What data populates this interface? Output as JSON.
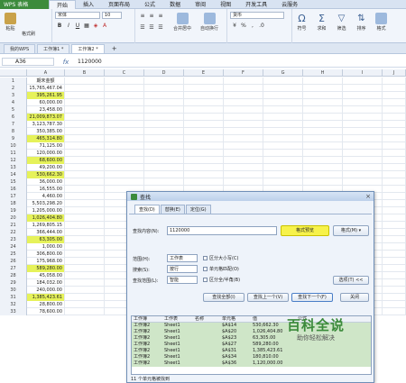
{
  "menubar": {
    "app_button": "WPS 表格",
    "items": [
      "开始",
      "插入",
      "页面布局",
      "公式",
      "数据",
      "审阅",
      "视图",
      "开发工具",
      "云服务"
    ],
    "active_index": 0
  },
  "ribbon": {
    "paste_label": "粘贴",
    "format_painter_label": "格式刷",
    "font_name": "宋体",
    "font_size": "10",
    "merge_label": "合并居中",
    "wrap_label": "自动换行",
    "number_format": "货币",
    "symbol_label": "符号",
    "sum_label": "求和",
    "filter_label": "筛选",
    "sort_label": "排序",
    "format_label": "格式",
    "accent_color": "#3c8b3c"
  },
  "tabs": {
    "items": [
      "我的WPS",
      "工作簿1 *",
      "工作簿2 *"
    ],
    "active_index": 2,
    "add_label": "+"
  },
  "formula_bar": {
    "cell_ref": "A36",
    "fx": "fx",
    "value": "1120000"
  },
  "sheet": {
    "columns": [
      "A",
      "B",
      "C",
      "D",
      "E",
      "F",
      "G",
      "H",
      "I",
      "J"
    ],
    "header_cell": "期末金额",
    "rows": [
      {
        "n": "1",
        "a": "期末金额",
        "hl": false
      },
      {
        "n": "2",
        "a": "15,765,467.04",
        "hl": false
      },
      {
        "n": "3",
        "a": "395,261.95",
        "hl": true
      },
      {
        "n": "4",
        "a": "60,000.00",
        "hl": false
      },
      {
        "n": "5",
        "a": "23,458.00",
        "hl": false
      },
      {
        "n": "6",
        "a": "21,009,873.07",
        "hl": true
      },
      {
        "n": "7",
        "a": "3,123,787.30",
        "hl": false
      },
      {
        "n": "8",
        "a": "350,385.00",
        "hl": false
      },
      {
        "n": "9",
        "a": "465,314.80",
        "hl": true
      },
      {
        "n": "10",
        "a": "71,125.00",
        "hl": false
      },
      {
        "n": "11",
        "a": "120,000.00",
        "hl": false
      },
      {
        "n": "12",
        "a": "68,600.00",
        "hl": true
      },
      {
        "n": "13",
        "a": "49,200.00",
        "hl": false
      },
      {
        "n": "14",
        "a": "530,662.30",
        "hl": true
      },
      {
        "n": "15",
        "a": "36,000.00",
        "hl": false
      },
      {
        "n": "16",
        "a": "16,555.00",
        "hl": false
      },
      {
        "n": "17",
        "a": "4,460.00",
        "hl": false
      },
      {
        "n": "18",
        "a": "5,503,298.20",
        "hl": false
      },
      {
        "n": "19",
        "a": "1,205,000.00",
        "hl": false
      },
      {
        "n": "20",
        "a": "1,026,404.80",
        "hl": true
      },
      {
        "n": "21",
        "a": "1,269,805.15",
        "hl": false
      },
      {
        "n": "22",
        "a": "366,444.00",
        "hl": false
      },
      {
        "n": "23",
        "a": "63,305.00",
        "hl": true
      },
      {
        "n": "24",
        "a": "1,000.00",
        "hl": false
      },
      {
        "n": "25",
        "a": "306,800.00",
        "hl": false
      },
      {
        "n": "26",
        "a": "175,968.00",
        "hl": false
      },
      {
        "n": "27",
        "a": "589,280.00",
        "hl": true
      },
      {
        "n": "28",
        "a": "45,058.00",
        "hl": false
      },
      {
        "n": "29",
        "a": "184,032.00",
        "hl": false
      },
      {
        "n": "30",
        "a": "240,000.00",
        "hl": false
      },
      {
        "n": "31",
        "a": "1,385,423.61",
        "hl": true
      },
      {
        "n": "32",
        "a": "28,800.00",
        "hl": false
      },
      {
        "n": "33",
        "a": "78,600.00",
        "hl": false
      }
    ]
  },
  "dialog": {
    "title": "查找",
    "close": "×",
    "tabs": [
      "查找(D)",
      "替换(E)",
      "定位(G)"
    ],
    "find_label": "查找内容(N):",
    "find_value": "1120000",
    "format_preview": "格式预览",
    "format_button": "格式(M) ▾",
    "scope_label": "范围(H):",
    "scope_value": "工作表",
    "search_label": "搜索(S):",
    "search_value": "按行",
    "lookin_label": "查找范围(L):",
    "lookin_value": "智能",
    "opt_case": "区分大小写(C)",
    "opt_cell": "单元格匹配(O)",
    "opt_width": "区分全/半角(B)",
    "options_button": "选项(T) <<",
    "find_all": "查找全部(I)",
    "find_prev": "查找上一个(V)",
    "find_next": "查找下一个(F)",
    "close_button": "关闭",
    "results_header": [
      "工作簿",
      "工作表",
      "名称",
      "单元格",
      "值",
      "公式"
    ],
    "results": [
      [
        "工作簿2",
        "Sheet1",
        "",
        "$A$14",
        "530,662.30",
        "",
        "sel"
      ],
      [
        "工作簿2",
        "Sheet1",
        "",
        "$A$20",
        "1,026,404.80",
        "",
        "sel"
      ],
      [
        "工作簿2",
        "Sheet1",
        "",
        "$A$23",
        "63,305.00",
        "",
        "sel"
      ],
      [
        "工作簿2",
        "Sheet1",
        "",
        "$A$27",
        "589,280.00",
        "",
        "sel"
      ],
      [
        "工作簿2",
        "Sheet1",
        "",
        "$A$31",
        "1,385,423.61",
        "",
        "sel"
      ],
      [
        "工作簿2",
        "Sheet1",
        "",
        "$A$34",
        "180,810.00",
        "",
        "sel"
      ],
      [
        "工作簿2",
        "Sheet1",
        "",
        "$A$36",
        "1,120,000.00",
        "",
        "sel"
      ]
    ],
    "status": "11 个单元格被找到"
  },
  "watermark": {
    "title": "百科全说",
    "subtitle": "助你轻松解决"
  }
}
